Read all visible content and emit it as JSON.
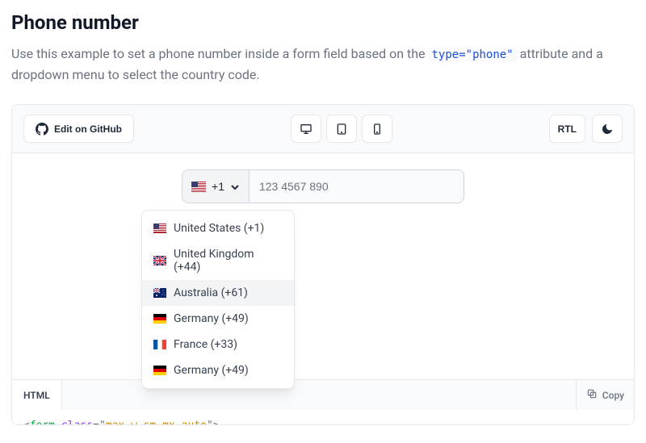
{
  "title": "Phone number",
  "description_prefix": "Use this example to set a phone number inside a form field based on the ",
  "description_code": "type=\"phone\"",
  "description_suffix": " attribute and a dropdown menu to select the country code.",
  "toolbar": {
    "github": "Edit on GitHub",
    "rtl": "RTL"
  },
  "phone": {
    "selected_code": "+1",
    "placeholder": "123 4567 890"
  },
  "countries": [
    {
      "label": "United States (+1)",
      "flag": "us"
    },
    {
      "label": "United Kingdom (+44)",
      "flag": "gb"
    },
    {
      "label": "Australia (+61)",
      "flag": "au",
      "highlight": true
    },
    {
      "label": "Germany (+49)",
      "flag": "de"
    },
    {
      "label": "France (+33)",
      "flag": "fr"
    },
    {
      "label": "Germany (+49)",
      "flag": "de"
    }
  ],
  "codebar": {
    "tab": "HTML",
    "copy": "Copy"
  },
  "code": {
    "lt": "<",
    "tag": "form",
    "attr": " : class",
    "attr_real": "class",
    "eq": "=",
    "q": "\"",
    "val": "max-w-sm mx-auto",
    "gt": ">"
  }
}
